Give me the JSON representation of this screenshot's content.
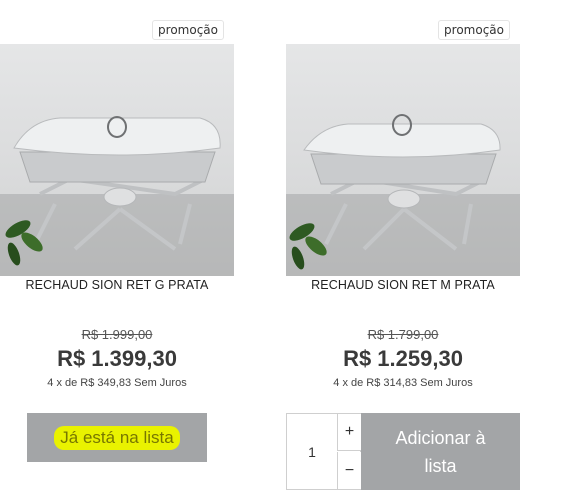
{
  "products": [
    {
      "badge": "promoção",
      "name": "RECHAUD SION RET G PRATA",
      "old_price": "R$ 1.999,00",
      "price": "R$ 1.399,30",
      "installments": "4 x de R$ 349,83 Sem Juros",
      "in_list_label": "Já está na lista"
    },
    {
      "badge": "promoção",
      "name": "RECHAUD SION RET M PRATA",
      "old_price": "R$ 1.799,00",
      "price": "R$ 1.259,30",
      "installments": "4 x de R$ 314,83 Sem Juros",
      "quantity": "1",
      "plus": "+",
      "minus": "−",
      "add_label": "Adicionar à lista"
    }
  ],
  "colors": {
    "button_bg": "#a3a5a7",
    "highlight": "#e9f200"
  }
}
